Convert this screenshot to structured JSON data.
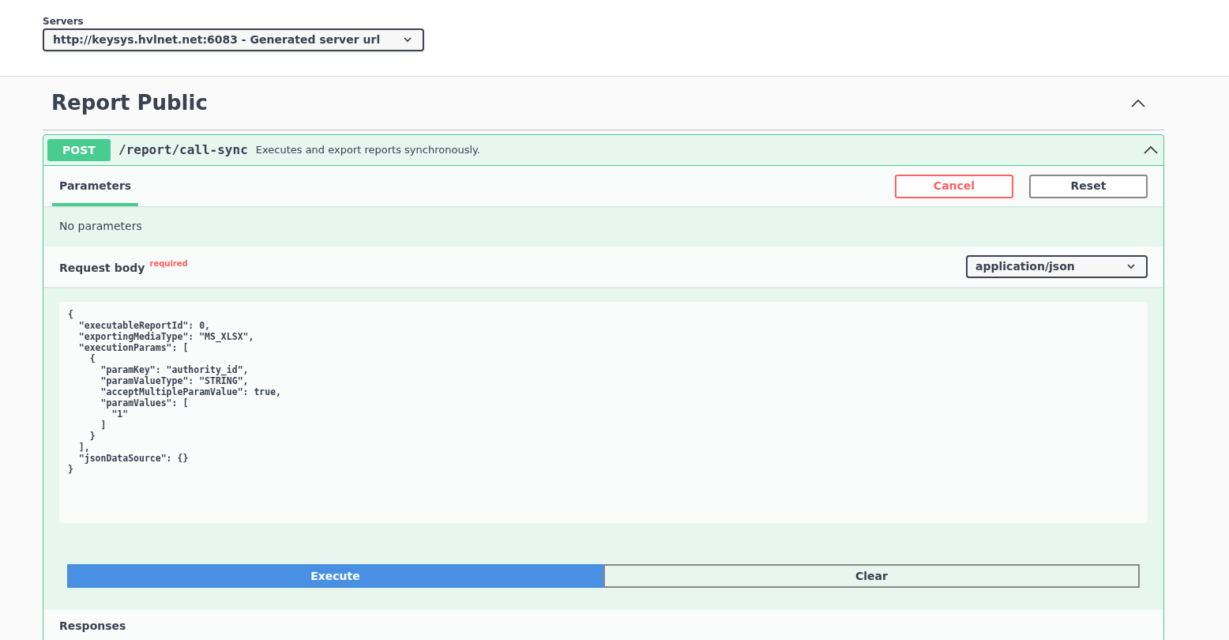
{
  "servers": {
    "label": "Servers",
    "selected": "http://keysys.hvlnet.net:6083 - Generated server url"
  },
  "section": {
    "title": "Report Public",
    "expanded": true
  },
  "operation": {
    "method": "POST",
    "path": "/report/call-sync",
    "summary": "Executes and export reports synchronously.",
    "expanded": true,
    "tabs": [
      {
        "label": "Parameters",
        "selected": true
      }
    ],
    "buttons": [
      {
        "label": "Cancel",
        "kind": "cancel"
      },
      {
        "label": "Reset",
        "kind": "reset"
      }
    ],
    "parameters_note": "No parameters",
    "request_body": {
      "title": "Request body",
      "required_label": "required",
      "content_type": "application/json",
      "value": "{\n  \"executableReportId\": 0,\n  \"exportingMediaType\": \"MS_XLSX\",\n  \"executionParams\": [\n    {\n      \"paramKey\": \"authority_id\",\n      \"paramValueType\": \"STRING\",\n      \"acceptMultipleParamValue\": true,\n      \"paramValues\": [\n        \"1\"\n      ]\n    }\n  ],\n  \"jsonDataSource\": {}\n}"
    },
    "actions": [
      {
        "label": "Execute",
        "kind": "execute"
      },
      {
        "label": "Clear",
        "kind": "clear"
      }
    ],
    "responses_title": "Responses"
  }
}
